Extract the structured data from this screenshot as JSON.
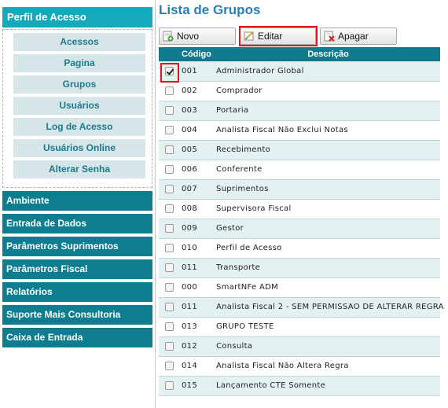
{
  "sidebar": {
    "perfil_title": "Perfil de Acesso",
    "sub_items": [
      {
        "label": "Acessos"
      },
      {
        "label": "Pagina"
      },
      {
        "label": "Grupos"
      },
      {
        "label": "Usuários"
      },
      {
        "label": "Log de Acesso"
      },
      {
        "label": "Usuários Online"
      },
      {
        "label": "Alterar Senha"
      }
    ],
    "menus": [
      {
        "label": "Ambiente"
      },
      {
        "label": "Entrada de Dados"
      },
      {
        "label": "Parâmetros Suprimentos"
      },
      {
        "label": "Parâmetros Fiscal"
      },
      {
        "label": "Relatórios"
      },
      {
        "label": "Suporte Mais Consultoria"
      },
      {
        "label": "Caixa de Entrada"
      }
    ]
  },
  "main": {
    "title": "Lista de Grupos",
    "toolbar": {
      "novo_label": "Novo",
      "editar_label": "Editar",
      "apagar_label": "Apagar"
    },
    "table": {
      "headers": {
        "code": "Código",
        "desc": "Descrição"
      },
      "rows": [
        {
          "code": "001",
          "desc": "Administrador Global",
          "checked": true
        },
        {
          "code": "002",
          "desc": "Comprador",
          "checked": false
        },
        {
          "code": "003",
          "desc": "Portaria",
          "checked": false
        },
        {
          "code": "004",
          "desc": "Analista Fiscal Não Exclui Notas",
          "checked": false
        },
        {
          "code": "005",
          "desc": "Recebimento",
          "checked": false
        },
        {
          "code": "006",
          "desc": "Conferente",
          "checked": false
        },
        {
          "code": "007",
          "desc": "Suprimentos",
          "checked": false
        },
        {
          "code": "008",
          "desc": "Supervisora Fiscal",
          "checked": false
        },
        {
          "code": "009",
          "desc": "Gestor",
          "checked": false
        },
        {
          "code": "010",
          "desc": "Perfil de Acesso",
          "checked": false
        },
        {
          "code": "011",
          "desc": "Transporte",
          "checked": false
        },
        {
          "code": "000",
          "desc": "SmartNFe ADM",
          "checked": false
        },
        {
          "code": "011",
          "desc": "Analista Fiscal 2 - SEM PERMISSAO DE ALTERAR REGRA",
          "checked": false
        },
        {
          "code": "013",
          "desc": "GRUPO TESTE",
          "checked": false
        },
        {
          "code": "012",
          "desc": "Consulta",
          "checked": false
        },
        {
          "code": "014",
          "desc": "Analista Fiscal Não Altera Regra",
          "checked": false
        },
        {
          "code": "015",
          "desc": "Lançamento CTE Somente",
          "checked": false
        }
      ]
    }
  },
  "icons": {
    "novo": "add-document-icon",
    "editar": "edit-document-icon",
    "apagar": "delete-document-icon"
  },
  "colors": {
    "sidebar_header": "#17a9bb",
    "menu_item": "#0e7d8f",
    "sub_item_bg": "#d6e6e8",
    "title": "#2b7fb4",
    "highlight": "#e0141b"
  }
}
